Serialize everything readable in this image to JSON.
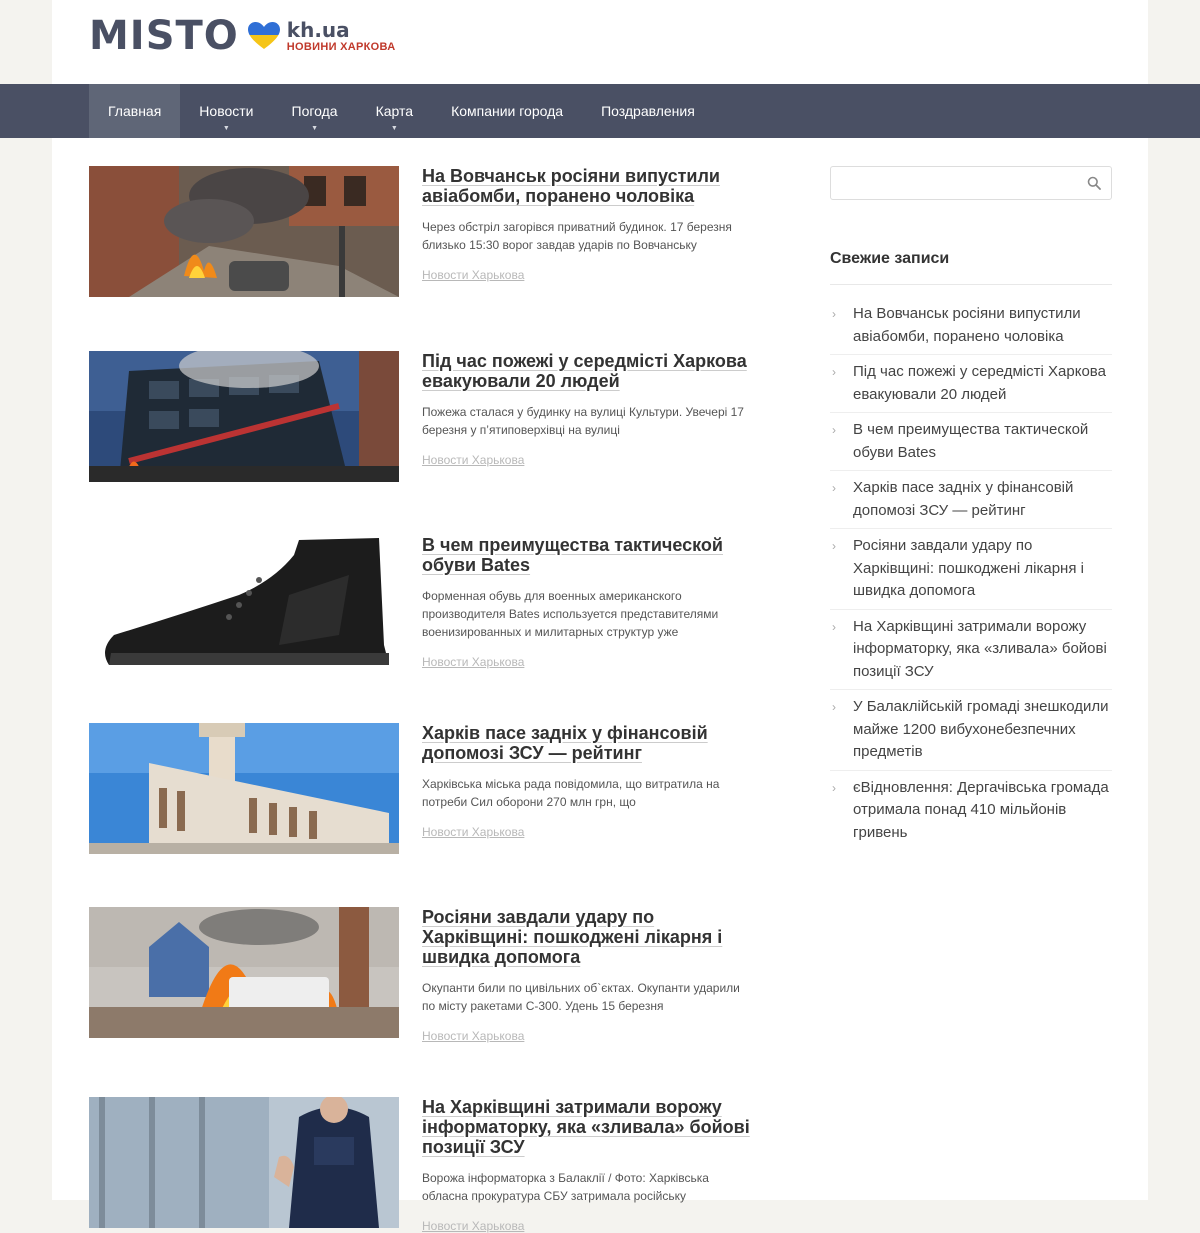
{
  "brand": {
    "name": "MISTO",
    "domain": "kh.ua",
    "tagline": "НОВИНИ ХАРКОВА",
    "heart_colors": [
      "#2f6fd6",
      "#f5c518"
    ]
  },
  "nav": {
    "items": [
      {
        "label": "Главная",
        "active": true,
        "has_dropdown": false
      },
      {
        "label": "Новости",
        "active": false,
        "has_dropdown": true
      },
      {
        "label": "Погода",
        "active": false,
        "has_dropdown": true
      },
      {
        "label": "Карта",
        "active": false,
        "has_dropdown": true
      },
      {
        "label": "Компании города",
        "active": false,
        "has_dropdown": false
      },
      {
        "label": "Поздравления",
        "active": false,
        "has_dropdown": false
      }
    ]
  },
  "articles": [
    {
      "title": "На Вовчанськ росіяни випустили авіабомби, поранено чоловіка",
      "excerpt": "Через обстріл загорівся приватний будинок. 17 березня близько 15:30 ворог завдав ударів по Вовчанську",
      "category": "Новости Харькова",
      "image": "fire-house"
    },
    {
      "title": "Під час пожежі у середмісті Харкова евакуювали 20 людей",
      "excerpt": "Пожежа сталася у будинку на вулиці Культури. Увечері 17 березня у п’ятиповерхівці на вулиці",
      "category": "Новости Харькова",
      "image": "fire-building"
    },
    {
      "title": "В чем преимущества тактической обуви Bates",
      "excerpt": "Форменная обувь для военных американского производителя Bates используется представителями военизированных и милитарных структур уже",
      "category": "Новости Харькова",
      "image": "boot"
    },
    {
      "title": "Харків пасе задніх у фінансовій допомозі ЗСУ — рейтинг",
      "excerpt": "Харківська міська рада повідомила, що витратила на потреби Сил оборони 270 млн грн, що",
      "category": "Новости Харькова",
      "image": "city-hall"
    },
    {
      "title": "Росіяни завдали удару по Харківщині: пошкоджені лікарня і швидка допомога",
      "excerpt": "Окупанти били по цивільних об`єктах. Окупанти ударили по місту ракетами С-300. Удень 15 березня",
      "category": "Новости Харькова",
      "image": "burning-ambulance"
    },
    {
      "title": "На Харківщині затримали ворожу інформаторку, яка «зливала» бойові позиції ЗСУ",
      "excerpt": "Ворожа інформаторка з Балаклії / Фото: Харківська обласна прокуратура СБУ затримала російську",
      "category": "Новости Харькова",
      "image": "prosecutor"
    }
  ],
  "sidebar": {
    "search_placeholder": "",
    "recent_title": "Свежие записи",
    "recent": [
      "На Вовчанськ росіяни випустили авіабомби, поранено чоловіка",
      "Під час пожежі у середмісті Харкова евакуювали 20 людей",
      "В чем преимущества тактической обуви Bates",
      "Харків пасе задніх у фінансовій допомозі ЗСУ — рейтинг",
      "Росіяни завдали удару по Харківщині: пошкоджені лікарня і швидка допомога",
      "На Харківщині затримали ворожу інформаторку, яка «зливала» бойові позиції ЗСУ",
      "У Балаклійській громаді знешкодили майже 1200 вибухонебезпечних предметів",
      "єВідновлення: Дергачівська громада отримала понад 410 мільйонів гривень"
    ]
  },
  "colors": {
    "nav_bg": "#4a5064",
    "nav_active": "#5f6677",
    "accent_red": "#c0392b"
  }
}
